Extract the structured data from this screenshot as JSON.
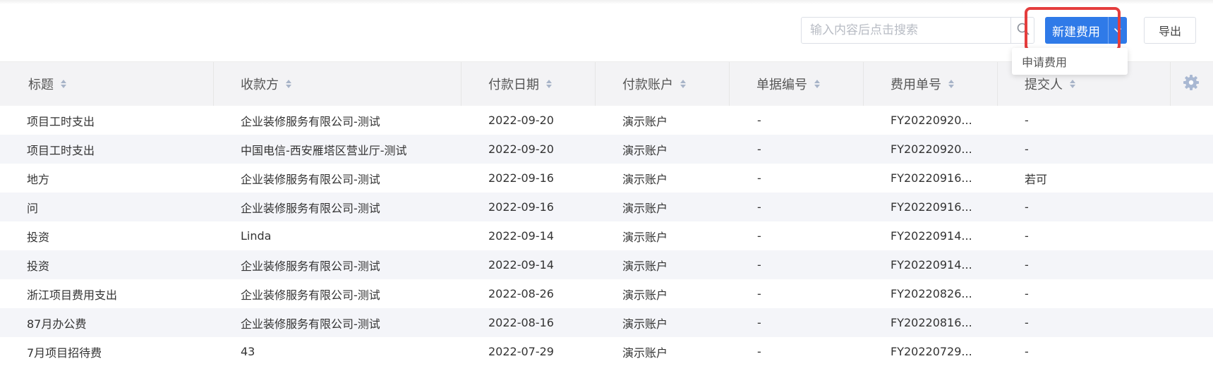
{
  "toolbar": {
    "search_placeholder": "输入内容后点击搜索",
    "search_value": "",
    "search_icon": "search-icon",
    "new_button_label": "新建费用",
    "new_button_caret_icon": "chevron-down-icon",
    "export_label": "导出",
    "accent_color": "#2f7ae8",
    "highlight_color": "#e43d3d"
  },
  "dropdown": {
    "items": [
      {
        "label": "申请费用"
      }
    ]
  },
  "table": {
    "headers": [
      "标题",
      "收款方",
      "付款日期",
      "付款账户",
      "单据编号",
      "费用单号",
      "提交人"
    ],
    "settings_icon": "gear-icon",
    "rows": [
      {
        "title": "项目工时支出",
        "payee": "企业装修服务有限公司-测试",
        "date": "2022-09-20",
        "account": "演示账户",
        "doc_no": "-",
        "fee_no": "FY20220920...",
        "submitter": "-"
      },
      {
        "title": "项目工时支出",
        "payee": "中国电信-西安雁塔区营业厅-测试",
        "date": "2022-09-20",
        "account": "演示账户",
        "doc_no": "-",
        "fee_no": "FY20220920...",
        "submitter": "-"
      },
      {
        "title": "地方",
        "payee": "企业装修服务有限公司-测试",
        "date": "2022-09-16",
        "account": "演示账户",
        "doc_no": "-",
        "fee_no": "FY20220916...",
        "submitter": "若可"
      },
      {
        "title": "问",
        "payee": "企业装修服务有限公司-测试",
        "date": "2022-09-16",
        "account": "演示账户",
        "doc_no": "-",
        "fee_no": "FY20220916...",
        "submitter": "-"
      },
      {
        "title": "投资",
        "payee": "Linda",
        "date": "2022-09-14",
        "account": "演示账户",
        "doc_no": "-",
        "fee_no": "FY20220914...",
        "submitter": "-"
      },
      {
        "title": "投资",
        "payee": "企业装修服务有限公司-测试",
        "date": "2022-09-14",
        "account": "演示账户",
        "doc_no": "-",
        "fee_no": "FY20220914...",
        "submitter": "-"
      },
      {
        "title": "浙江项目费用支出",
        "payee": "企业装修服务有限公司-测试",
        "date": "2022-08-26",
        "account": "演示账户",
        "doc_no": "-",
        "fee_no": "FY20220826...",
        "submitter": "-"
      },
      {
        "title": "87月办公费",
        "payee": "企业装修服务有限公司-测试",
        "date": "2022-08-16",
        "account": "演示账户",
        "doc_no": "-",
        "fee_no": "FY20220816...",
        "submitter": "-"
      },
      {
        "title": "7月项目招待费",
        "payee": "43",
        "date": "2022-07-29",
        "account": "演示账户",
        "doc_no": "-",
        "fee_no": "FY20220729...",
        "submitter": "-"
      }
    ]
  }
}
